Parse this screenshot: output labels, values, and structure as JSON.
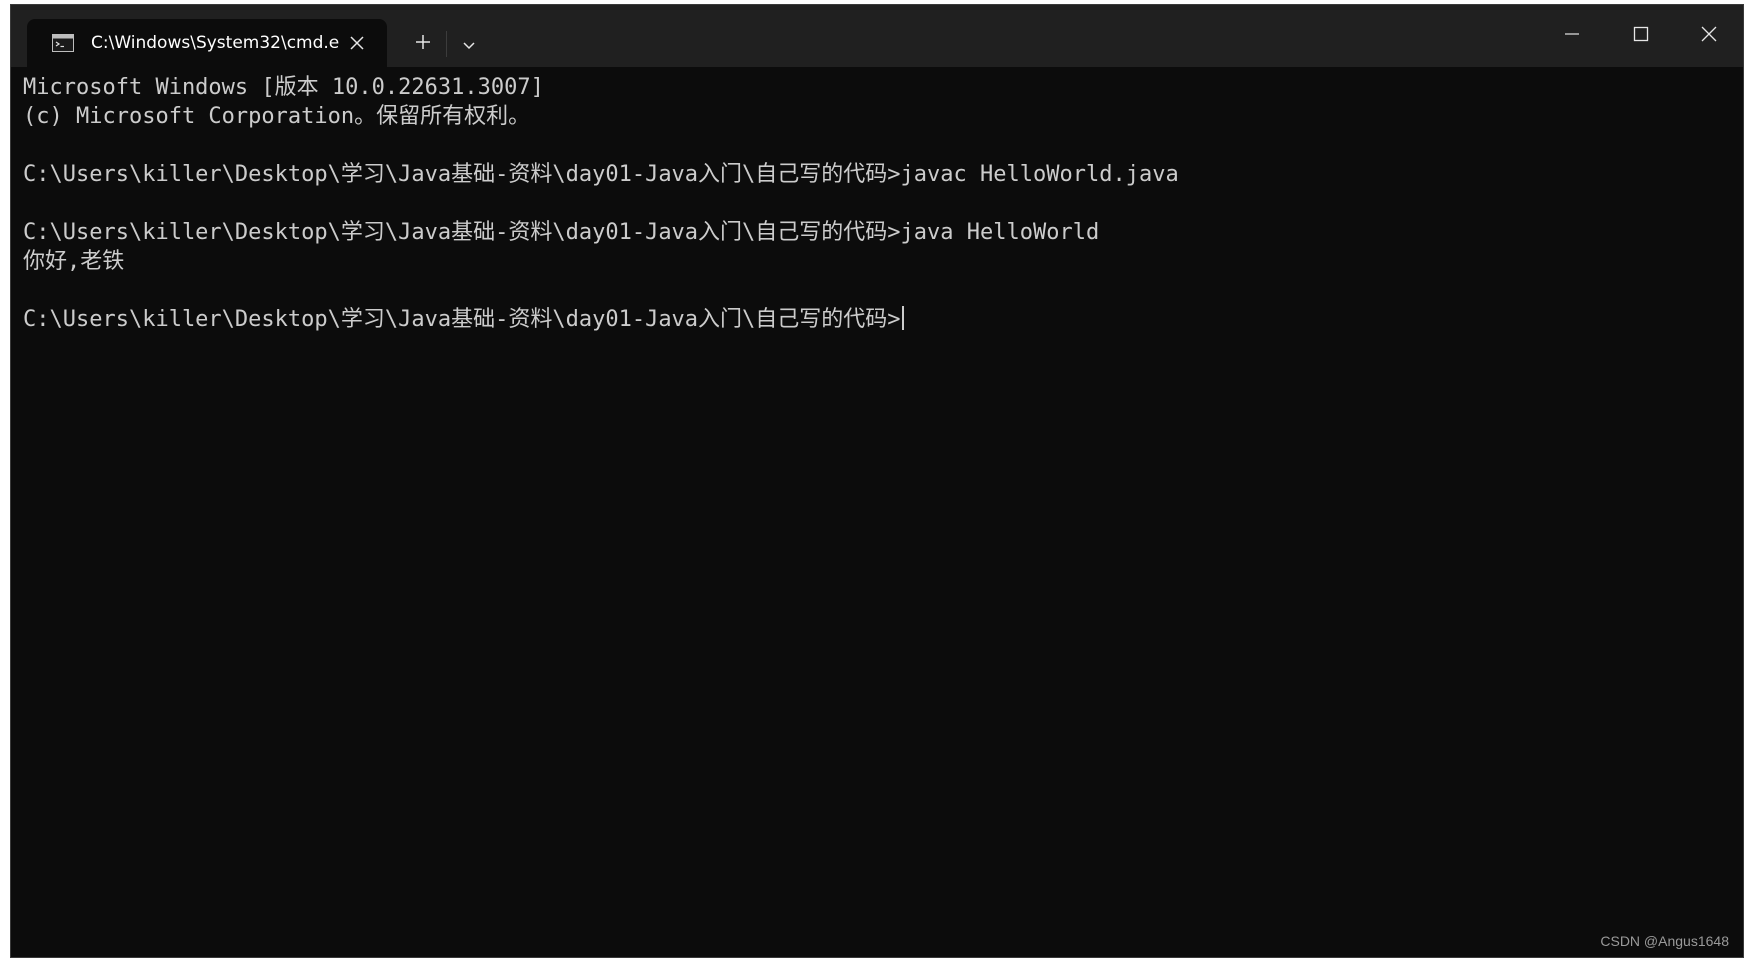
{
  "tab": {
    "title": "C:\\Windows\\System32\\cmd.e"
  },
  "terminal": {
    "lines": [
      "Microsoft Windows [版本 10.0.22631.3007]",
      "(c) Microsoft Corporation。保留所有权利。",
      "",
      "C:\\Users\\killer\\Desktop\\学习\\Java基础-资料\\day01-Java入门\\自己写的代码>javac HelloWorld.java",
      "",
      "C:\\Users\\killer\\Desktop\\学习\\Java基础-资料\\day01-Java入门\\自己写的代码>java HelloWorld",
      "你好,老铁",
      "",
      "C:\\Users\\killer\\Desktop\\学习\\Java基础-资料\\day01-Java入门\\自己写的代码>"
    ]
  },
  "watermark": "CSDN @Angus1648",
  "icons": {
    "tab": "terminal-icon",
    "close_tab": "close-icon",
    "new_tab": "plus-icon",
    "dropdown": "chevron-down-icon",
    "minimize": "minimize-icon",
    "maximize": "maximize-icon",
    "close": "close-icon"
  },
  "colors": {
    "terminal_bg": "#0c0c0c",
    "titlebar_bg": "#202020",
    "text": "#cccccc"
  }
}
